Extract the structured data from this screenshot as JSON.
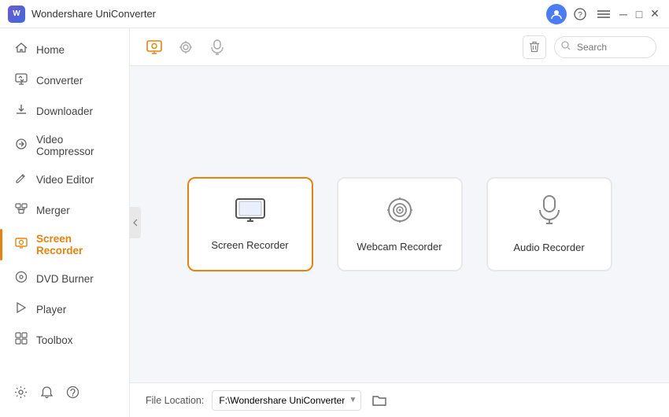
{
  "app": {
    "title": "Wondershare UniConverter",
    "logo_letter": "W"
  },
  "titlebar": {
    "user_icon": "👤",
    "help_icon": "🎧",
    "menu_icon": "☰",
    "minimize_icon": "─",
    "maximize_icon": "□",
    "close_icon": "✕"
  },
  "sidebar": {
    "items": [
      {
        "id": "home",
        "label": "Home",
        "icon": "⌂",
        "active": false
      },
      {
        "id": "converter",
        "label": "Converter",
        "icon": "↓",
        "active": false
      },
      {
        "id": "downloader",
        "label": "Downloader",
        "icon": "⬇",
        "active": false
      },
      {
        "id": "video-compressor",
        "label": "Video Compressor",
        "icon": "⚙",
        "active": false
      },
      {
        "id": "video-editor",
        "label": "Video Editor",
        "icon": "✂",
        "active": false
      },
      {
        "id": "merger",
        "label": "Merger",
        "icon": "⊞",
        "active": false
      },
      {
        "id": "screen-recorder",
        "label": "Screen Recorder",
        "icon": "⬤",
        "active": true
      },
      {
        "id": "dvd-burner",
        "label": "DVD Burner",
        "icon": "⊙",
        "active": false
      },
      {
        "id": "player",
        "label": "Player",
        "icon": "▷",
        "active": false
      },
      {
        "id": "toolbox",
        "label": "Toolbox",
        "icon": "⊞",
        "active": false
      }
    ],
    "bottom_icons": [
      "?",
      "🔔",
      "☺"
    ]
  },
  "topbar": {
    "tabs": [
      {
        "id": "screen",
        "icon": "🖥",
        "active": true
      },
      {
        "id": "webcam",
        "icon": "⊙",
        "active": false
      },
      {
        "id": "audio",
        "icon": "🎤",
        "active": false
      }
    ],
    "search_placeholder": "Search"
  },
  "recorder_cards": [
    {
      "id": "screen-recorder",
      "label": "Screen Recorder",
      "icon": "screen",
      "selected": true
    },
    {
      "id": "webcam-recorder",
      "label": "Webcam Recorder",
      "icon": "webcam",
      "selected": false
    },
    {
      "id": "audio-recorder",
      "label": "Audio Recorder",
      "icon": "mic",
      "selected": false
    }
  ],
  "bottombar": {
    "file_location_label": "File Location:",
    "file_location_value": "F:\\Wondershare UniConverter",
    "folder_icon": "📁"
  }
}
